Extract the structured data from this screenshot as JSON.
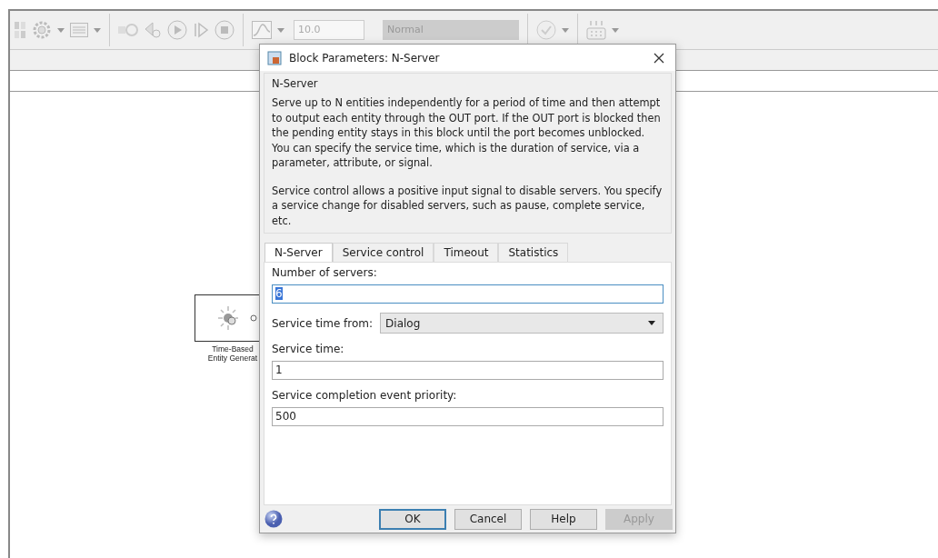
{
  "toolbar": {
    "stop_time": "10.0",
    "mode": "Normal"
  },
  "canvas": {
    "block": {
      "label_lines": [
        "Time-Based",
        "Entity Generat"
      ]
    }
  },
  "dialog": {
    "title": "Block Parameters: N-Server",
    "group": "N-Server",
    "description": [
      "Serve up to N entities independently for a period of time and then attempt to output each entity through the OUT port. If the OUT port is blocked then the pending entity stays in this block until the port becomes unblocked. You can specify the service time, which is the duration of service, via a parameter, attribute, or signal.",
      "Service control allows a positive input signal to disable servers. You specify a service change for disabled servers, such as pause, complete service, etc."
    ],
    "tabs": [
      {
        "label": "N-Server",
        "selected": true
      },
      {
        "label": "Service control",
        "selected": false
      },
      {
        "label": "Timeout",
        "selected": false
      },
      {
        "label": "Statistics",
        "selected": false
      }
    ],
    "fields": [
      {
        "kind": "text",
        "label": "Number of servers:",
        "value": "6",
        "focused": true
      },
      {
        "kind": "select",
        "label": "Service time from:",
        "value": "Dialog",
        "focused": false
      },
      {
        "kind": "text",
        "label": "Service time:",
        "value": "1",
        "focused": false
      },
      {
        "kind": "text",
        "label": "Service completion event priority:",
        "value": "500",
        "focused": false
      }
    ],
    "buttons": [
      {
        "label": "OK",
        "disabled": false,
        "default": true
      },
      {
        "label": "Cancel",
        "disabled": false,
        "default": false
      },
      {
        "label": "Help",
        "disabled": false,
        "default": false
      },
      {
        "label": "Apply",
        "disabled": true,
        "default": false
      }
    ]
  }
}
